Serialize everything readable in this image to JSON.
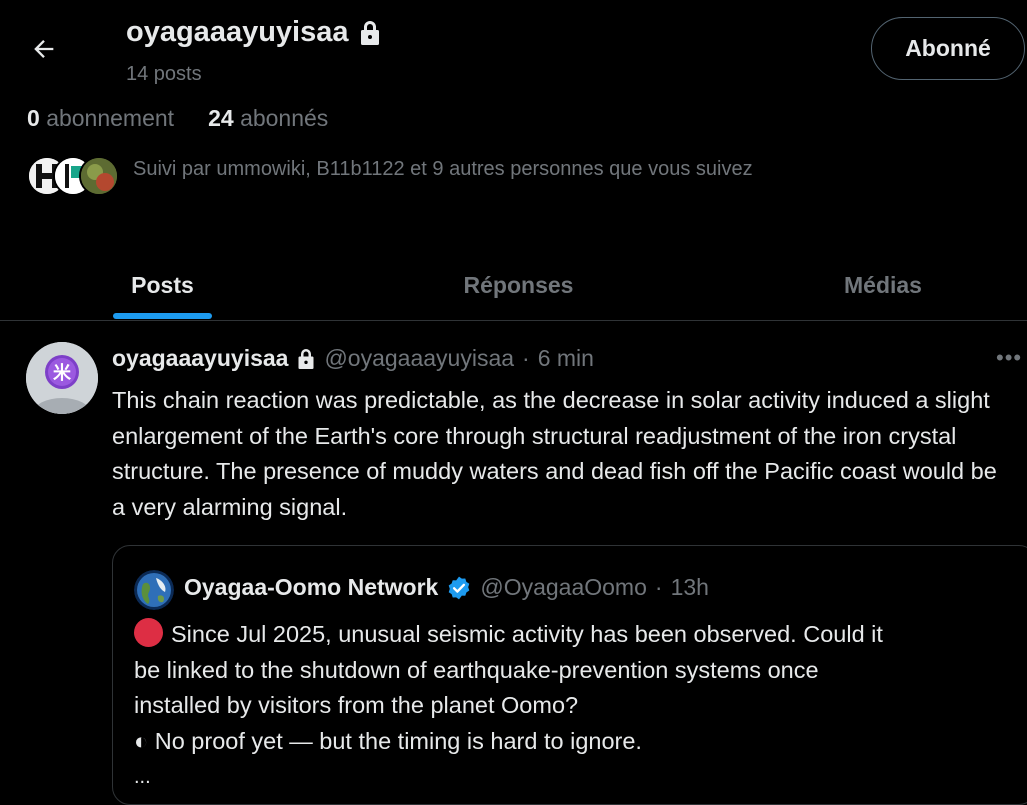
{
  "header": {
    "back_icon": "arrow-left-icon",
    "name": "oyagaaayuyisaa",
    "lock_icon": "lock-icon",
    "posts_count": "14 posts",
    "follow_button": "Abonné"
  },
  "stats": {
    "following_count": "0",
    "following_label": "abonnement",
    "followers_count": "24",
    "followers_label": "abonnés"
  },
  "followed_by": {
    "text": "Suivi par ummowiki, B11b1122 et 9 autres personnes que vous suivez"
  },
  "tabs": [
    {
      "label": "Posts",
      "active": true
    },
    {
      "label": "Réponses",
      "active": false
    },
    {
      "label": "Médias",
      "active": false
    }
  ],
  "tweet": {
    "name": "oyagaaayuyisaa",
    "handle": "@oyagaaayuyisaa",
    "separator": "·",
    "time": "6 min",
    "more_icon": "more-dots-icon",
    "text": "This chain reaction was predictable, as the decrease in solar activity induced a slight enlargement of the Earth's core through structural readjustment of the iron crystal structure. The presence of muddy waters and dead fish off the Pacific coast would be a very alarming signal.",
    "quote": {
      "name": "Oyagaa-Oomo Network",
      "verified_icon": "verified-badge-icon",
      "handle": "@OyagaaOomo",
      "separator": "·",
      "time": "13h",
      "line1": "Since Jul 2025, unusual seismic activity has been observed. Could it",
      "line2": "be linked to the shutdown of earthquake-prevention systems once",
      "line3": "installed by visitors from the planet Oomo?",
      "line4": "◐ No proof yet — but the timing is hard to ignore.",
      "ellipsis": "..."
    }
  },
  "colors": {
    "accent": "#1d9bf0",
    "muted": "#71767b",
    "background": "#000000",
    "text": "#e7e9ea",
    "border": "#2f3336"
  }
}
